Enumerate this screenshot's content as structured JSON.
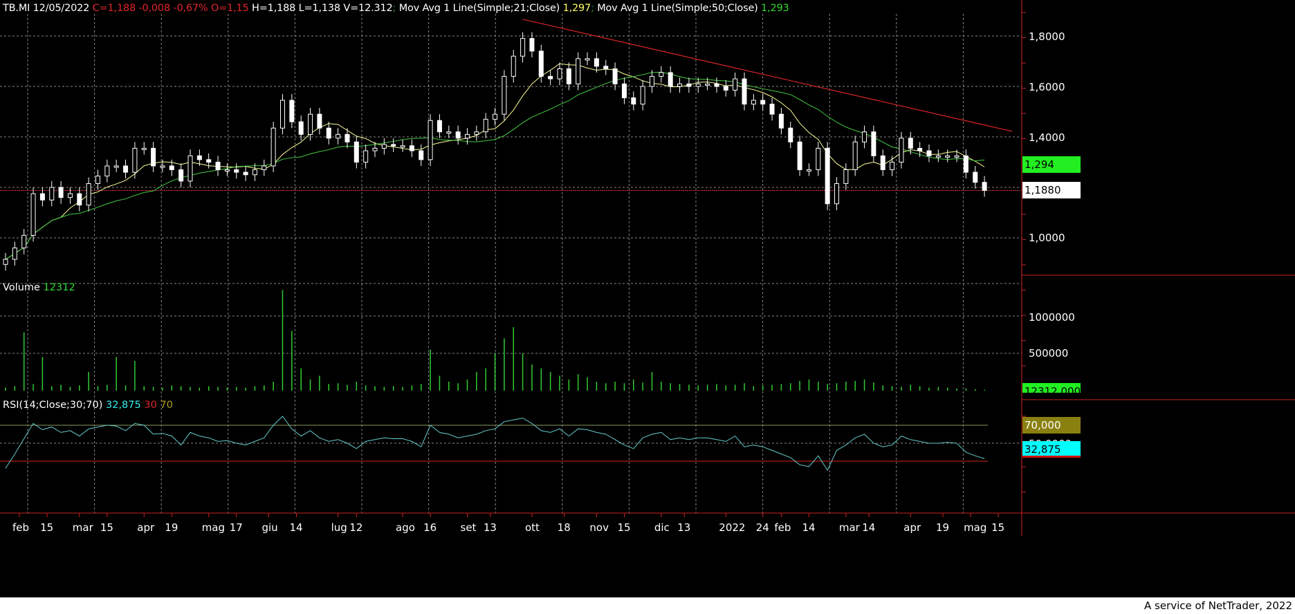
{
  "header": {
    "symbol": "TB.MI",
    "date": "12/05/2022",
    "close": "C=1,188",
    "change": "-0,008",
    "change_pct": "-0,67%",
    "open": "O=1,15",
    "high": "H=1,188",
    "low": "L=1,138",
    "volume": "V=12.312",
    "ma1_label": "Mov Avg 1 Line(Simple;21;Close)",
    "ma1_value": "1,297",
    "ma2_label": "Mov Avg 1 Line(Simple;50;Close)",
    "ma2_value": "1,293",
    "separator": ";"
  },
  "volume_panel": {
    "label": "Volume",
    "value": "12312",
    "tag": "12312,000"
  },
  "rsi_panel": {
    "label": "RSI(14;Close;30;70)",
    "value": "32,875",
    "low": "30",
    "high": "70",
    "tag_high": "70,000",
    "tag_value": "32,875"
  },
  "price_tags": {
    "ma": "1,294",
    "last": "1,1880"
  },
  "footer": {
    "text": "A service of NetTrader, 2022"
  },
  "colors": {
    "up": "#ffffff",
    "ma21": "#ffff99",
    "ma50": "#44cc44",
    "trend": "#cc2222",
    "volume": "#33cc33",
    "rsi": "#66cccc",
    "axis": "#cc2222"
  },
  "chart_data": [
    {
      "type": "candlestick",
      "title": "TB.MI",
      "y_ticks": [
        "1,8000",
        "1,6000",
        "1,4000",
        "1,0000"
      ],
      "y_tick_values": [
        1.8,
        1.6,
        1.4,
        1.0
      ],
      "ylim": [
        0.85,
        1.9
      ],
      "last_price": 1.188,
      "x_ticks": [
        "feb",
        "15",
        "mar",
        "15",
        "apr",
        "19",
        "mag",
        "17",
        "giu",
        "14",
        "lug",
        "12",
        "ago",
        "16",
        "set",
        "13",
        "ott",
        "18",
        "nov",
        "15",
        "dic",
        "13",
        "2022",
        "24",
        "feb",
        "14",
        "mar",
        "14",
        "apr",
        "19",
        "mag",
        "15"
      ],
      "x_tick_index": [
        1.5,
        4.5,
        8,
        11,
        15,
        18,
        22,
        25,
        28.5,
        31.5,
        36,
        38,
        43,
        46,
        50,
        52.5,
        57,
        60.5,
        64,
        67,
        71,
        73.5,
        78,
        82,
        84,
        87,
        91,
        93.5,
        98,
        101.5,
        104.5,
        107.5
      ],
      "closes": [
        0.915,
        0.96,
        1.01,
        1.175,
        1.15,
        1.2,
        1.16,
        1.175,
        1.13,
        1.215,
        1.245,
        1.285,
        1.285,
        1.26,
        1.355,
        1.355,
        1.285,
        1.285,
        1.27,
        1.225,
        1.325,
        1.31,
        1.3,
        1.27,
        1.27,
        1.26,
        1.25,
        1.27,
        1.285,
        1.435,
        1.545,
        1.46,
        1.41,
        1.49,
        1.435,
        1.395,
        1.41,
        1.38,
        1.3,
        1.345,
        1.355,
        1.37,
        1.365,
        1.365,
        1.345,
        1.31,
        1.465,
        1.42,
        1.42,
        1.395,
        1.41,
        1.42,
        1.47,
        1.49,
        1.64,
        1.72,
        1.79,
        1.74,
        1.64,
        1.63,
        1.67,
        1.61,
        1.71,
        1.71,
        1.68,
        1.67,
        1.61,
        1.555,
        1.53,
        1.6,
        1.64,
        1.655,
        1.6,
        1.61,
        1.6,
        1.61,
        1.61,
        1.6,
        1.585,
        1.63,
        1.53,
        1.545,
        1.53,
        1.49,
        1.435,
        1.38,
        1.27,
        1.27,
        1.355,
        1.135,
        1.215,
        1.27,
        1.38,
        1.42,
        1.325,
        1.27,
        1.3,
        1.395,
        1.355,
        1.345,
        1.325,
        1.325,
        1.325,
        1.325,
        1.26,
        1.22,
        1.188
      ],
      "series": [
        {
          "name": "Mov Avg 1 Line(Simple;21;Close)",
          "last": 1.297
        },
        {
          "name": "Mov Avg 1 Line(Simple;50;Close)",
          "last": 1.293
        }
      ],
      "trendline": {
        "from": [
          56,
          1.866
        ],
        "to": [
          109,
          1.422
        ]
      }
    },
    {
      "type": "bar",
      "title": "Volume",
      "y_ticks": [
        "1000000",
        "500000"
      ],
      "y_tick_values": [
        1000000,
        500000
      ],
      "ylim": [
        0,
        1500000
      ],
      "values": [
        40000,
        60000,
        780000,
        90000,
        450000,
        60000,
        80000,
        50000,
        70000,
        250000,
        60000,
        80000,
        450000,
        70000,
        400000,
        60000,
        50000,
        40000,
        70000,
        60000,
        50000,
        40000,
        60000,
        50000,
        40000,
        50000,
        40000,
        60000,
        70000,
        120000,
        1350000,
        800000,
        300000,
        150000,
        200000,
        90000,
        100000,
        80000,
        120000,
        70000,
        60000,
        50000,
        60000,
        50000,
        70000,
        90000,
        550000,
        200000,
        120000,
        100000,
        150000,
        250000,
        300000,
        500000,
        700000,
        850000,
        500000,
        350000,
        300000,
        250000,
        200000,
        150000,
        220000,
        180000,
        120000,
        100000,
        120000,
        100000,
        150000,
        110000,
        250000,
        120000,
        100000,
        90000,
        80000,
        70000,
        80000,
        90000,
        70000,
        80000,
        100000,
        60000,
        70000,
        80000,
        90000,
        100000,
        130000,
        150000,
        120000,
        90000,
        100000,
        120000,
        130000,
        150000,
        110000,
        70000,
        60000,
        50000,
        80000,
        60000,
        40000,
        50000,
        40000,
        30000,
        30000,
        20000,
        12312
      ]
    },
    {
      "type": "line",
      "title": "RSI(14;Close;30;70)",
      "y_ticks": [
        "70,000",
        "50,0000"
      ],
      "levels": [
        30,
        70
      ],
      "ylim": [
        10,
        90
      ],
      "values": [
        22,
        38,
        55,
        72,
        65,
        68,
        62,
        64,
        58,
        66,
        68,
        70,
        69,
        64,
        72,
        70,
        60,
        61,
        58,
        48,
        62,
        58,
        56,
        52,
        53,
        50,
        48,
        52,
        56,
        70,
        80,
        66,
        58,
        64,
        56,
        52,
        54,
        50,
        44,
        52,
        54,
        56,
        55,
        55,
        52,
        46,
        70,
        62,
        60,
        56,
        58,
        60,
        64,
        66,
        74,
        76,
        78,
        72,
        64,
        62,
        66,
        58,
        66,
        65,
        62,
        60,
        54,
        48,
        44,
        56,
        60,
        62,
        54,
        56,
        54,
        56,
        56,
        54,
        52,
        58,
        46,
        48,
        46,
        42,
        38,
        34,
        26,
        24,
        36,
        20,
        42,
        48,
        56,
        60,
        50,
        46,
        48,
        58,
        54,
        52,
        50,
        50,
        51,
        50,
        40,
        36,
        32.875
      ]
    }
  ]
}
